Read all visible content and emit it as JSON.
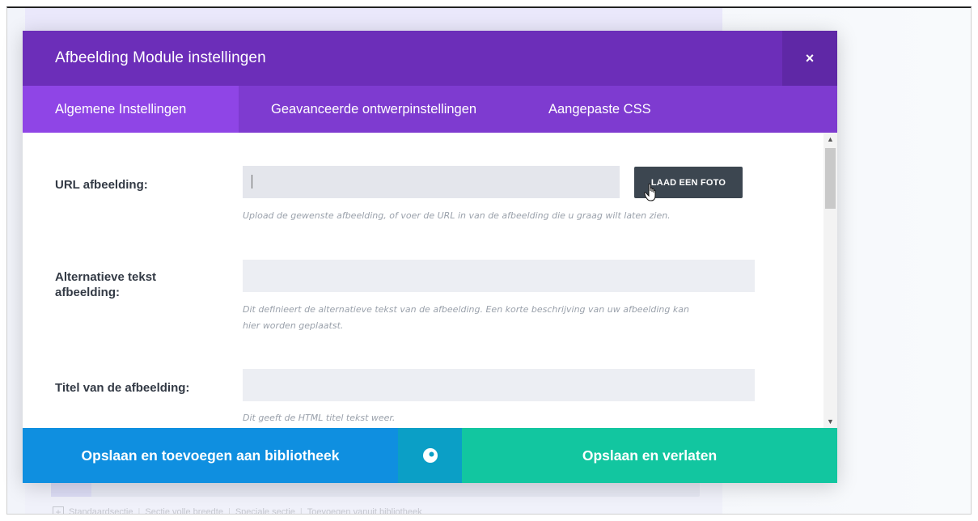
{
  "background": {
    "links": [
      "Standaardsectie",
      "Sectie volle breedte",
      "Speciale sectie",
      "Toevoegen vanuit bibliotheek"
    ]
  },
  "modal": {
    "title": "Afbeelding Module instellingen",
    "close_icon": "×"
  },
  "tabs": [
    {
      "label": "Algemene Instellingen",
      "active": true
    },
    {
      "label": "Geavanceerde ontwerpinstellingen",
      "active": false
    },
    {
      "label": "Aangepaste CSS",
      "active": false
    }
  ],
  "fields": {
    "url": {
      "label": "URL afbeelding:",
      "value": "",
      "button": "LAAD EEN FOTO",
      "description": "Upload de gewenste afbeelding, of voer de URL in van de afbeelding die u graag wilt laten zien."
    },
    "alt": {
      "label_line1": "Alternatieve tekst",
      "label_line2": "afbeelding:",
      "value": "",
      "description_line1": "Dit definieert de alternatieve tekst van de afbeelding. Een korte beschrijving van uw afbeelding kan",
      "description_line2": "hier worden geplaatst."
    },
    "title": {
      "label": "Titel van de afbeelding:",
      "value": "",
      "description": "Dit geeft de HTML titel tekst weer."
    }
  },
  "footer": {
    "library_label": "Opslaan en toevoegen aan bibliotheek",
    "preview_icon": "eye-icon",
    "save_label": "Opslaan en verlaten"
  },
  "colors": {
    "header": "#6c2eb9",
    "tabs": "#7e3bd0",
    "active_tab": "#8f45e6",
    "library_button": "#0f8fe0",
    "preview_button": "#0b9fc6",
    "save_button": "#12c6a0"
  }
}
